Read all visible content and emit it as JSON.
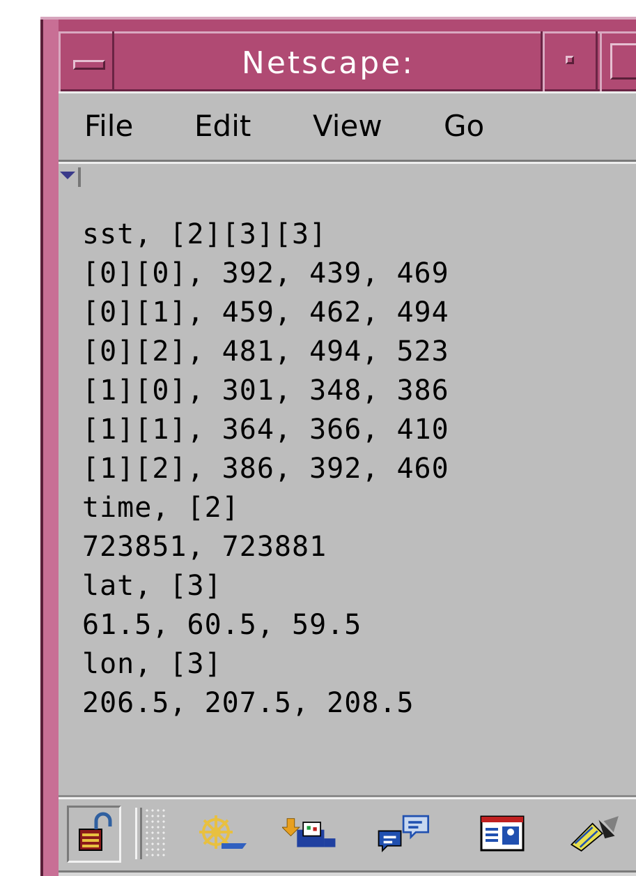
{
  "window": {
    "title": "Netscape:"
  },
  "menubar": {
    "items": [
      "File",
      "Edit",
      "View",
      "Go"
    ]
  },
  "content": {
    "lines": [
      "sst, [2][3][3]",
      "[0][0], 392, 439, 469",
      "[0][1], 459, 462, 494",
      "[0][2], 481, 494, 523",
      "[1][0], 301, 348, 386",
      "[1][1], 364, 366, 410",
      "[1][2], 386, 392, 460",
      "time, [2]",
      "723851, 723881",
      "lat, [3]",
      "61.5, 60.5, 59.5",
      "lon, [3]",
      "206.5, 207.5, 208.5"
    ]
  },
  "toolbar": {
    "icons": [
      "security-lock-icon",
      "navigator-compass-icon",
      "download-inbox-icon",
      "discussions-icon",
      "composer-icon",
      "editor-pen-icon"
    ]
  },
  "colors": {
    "title_bar": "#b04a73",
    "window_bg": "#bdbdbd"
  }
}
